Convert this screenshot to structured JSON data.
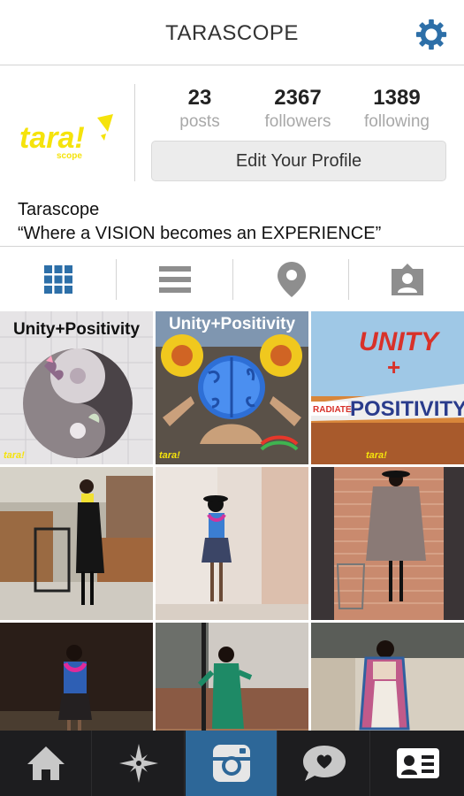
{
  "header": {
    "title": "TARASCOPE",
    "settings_icon": "gear-icon",
    "accent": "#2d6fa8"
  },
  "profile": {
    "logo_text": "tara!",
    "logo_subtext": "scope",
    "logo_color": "#f5e30c",
    "stats": [
      {
        "value": "23",
        "label": "posts"
      },
      {
        "value": "2367",
        "label": "followers"
      },
      {
        "value": "1389",
        "label": "following"
      }
    ],
    "edit_button_label": "Edit Your Profile",
    "name": "Tarascope",
    "bio": "“Where a VISION becomes an EXPERIENCE”"
  },
  "tabs": [
    {
      "icon": "grid-icon",
      "active": true
    },
    {
      "icon": "list-icon",
      "active": false
    },
    {
      "icon": "map-pin-icon",
      "active": false
    },
    {
      "icon": "tagged-photos-icon",
      "active": false
    }
  ],
  "posts": [
    {
      "caption": "Unity+Positivity",
      "kind": "puzzle-yin-yang"
    },
    {
      "caption": "Unity+Positivity",
      "kind": "puzzle-brain"
    },
    {
      "caption": "UNITY + RADIATE POSITIVITY",
      "kind": "puzzle-graffiti"
    },
    {
      "caption": "",
      "kind": "photo"
    },
    {
      "caption": "",
      "kind": "photo"
    },
    {
      "caption": "",
      "kind": "photo"
    },
    {
      "caption": "",
      "kind": "photo"
    },
    {
      "caption": "",
      "kind": "photo"
    },
    {
      "caption": "",
      "kind": "photo"
    }
  ],
  "bottom_nav": [
    {
      "icon": "home-icon",
      "active": false
    },
    {
      "icon": "explore-star-icon",
      "active": false
    },
    {
      "icon": "camera-icon",
      "active": true
    },
    {
      "icon": "activity-bubble-icon",
      "active": false
    },
    {
      "icon": "profile-card-icon",
      "active": false
    }
  ]
}
